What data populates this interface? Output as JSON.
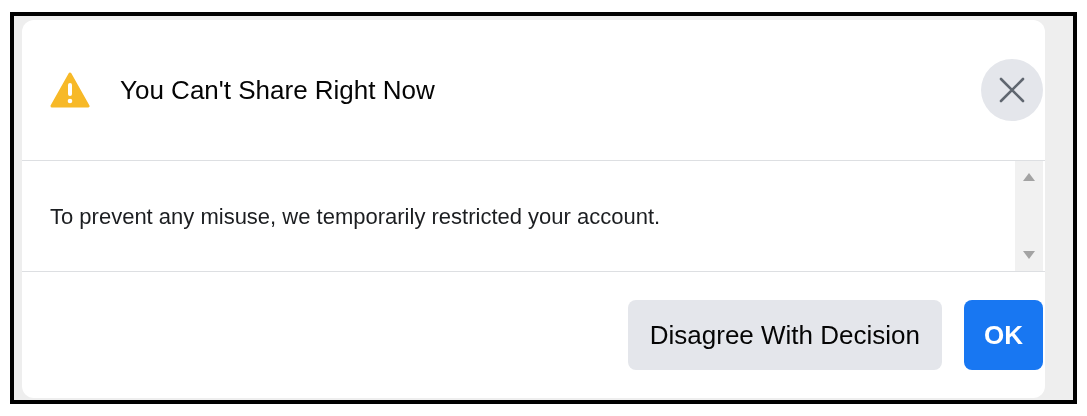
{
  "dialog": {
    "title": "You Can't Share Right Now",
    "message": "To prevent any misuse, we temporarily restricted your account.",
    "buttons": [
      {
        "label": "Disagree With Decision",
        "kind": "secondary"
      },
      {
        "label": "OK",
        "kind": "primary"
      }
    ]
  }
}
